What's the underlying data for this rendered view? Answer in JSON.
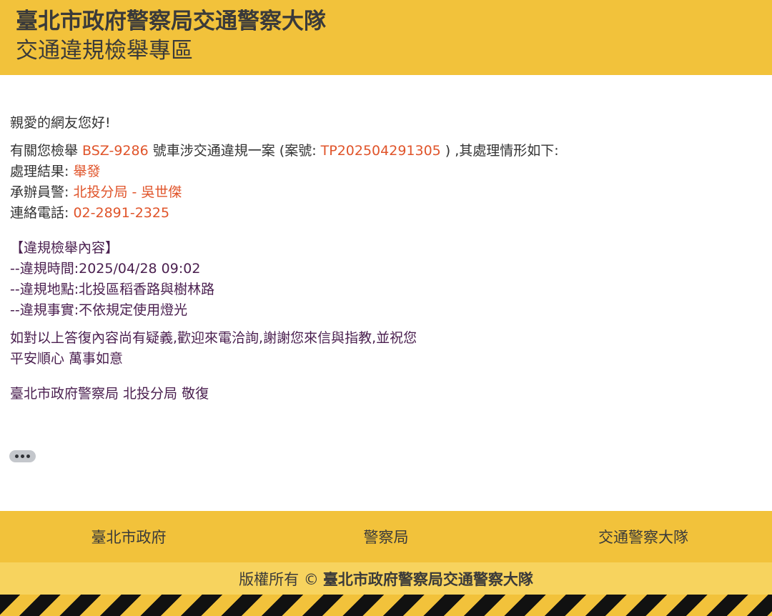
{
  "header": {
    "title": "臺北市政府警察局交通警察大隊",
    "subtitle": "交通違規檢舉專區"
  },
  "message": {
    "greeting": "親愛的網友您好!",
    "intro_prefix": "有關您檢舉 ",
    "plate": "BSZ-9286",
    "intro_middle": " 號車涉交通違規一案 (案號:  ",
    "case_number": "TP202504291305",
    "intro_suffix": " ) ,其處理情形如下:",
    "result_label": "處理結果:  ",
    "result_value": "舉發",
    "officer_label": "承辦員警:  ",
    "officer_value": "北投分局 - 吳世傑",
    "phone_label": "連絡電話:  ",
    "phone_value": "02-2891-2325",
    "violation_heading": "【違規檢舉內容】",
    "time_label": "--違規時間:",
    "time_value": "2025/04/28 09:02",
    "location_label": "--違規地點:",
    "location_value": "北投區稻香路與樹林路",
    "fact_label": "--違規事實:",
    "fact_value": "不依規定使用燈光",
    "closing_line1": "如對以上答復內容尚有疑義,歡迎來電洽詢,謝謝您來信與指教,並祝您",
    "closing_line2": "平安順心 萬事如意",
    "signature": "臺北市政府警察局 北投分局 敬復"
  },
  "more_button_icon": "ellipsis-icon",
  "footer": {
    "links": [
      "臺北市政府",
      "警察局",
      "交通警察大隊"
    ],
    "copyright_prefix": "版權所有 ©",
    "copyright_owner": "臺北市政府警察局交通警察大隊"
  },
  "colors": {
    "header_bg": "#f2c23b",
    "highlight": "#e0542a",
    "violation_text": "#4a1f4f",
    "copyright_bg": "#f7d35e"
  }
}
